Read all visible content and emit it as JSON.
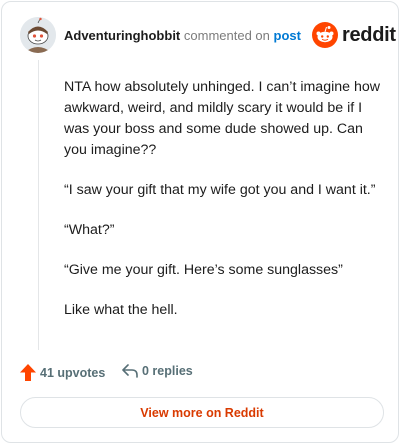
{
  "header": {
    "username": "Adventuringhobbit",
    "action_text": "commented on",
    "post_link": "post",
    "brand": "reddit"
  },
  "comment": {
    "paragraphs": [
      "NTA how absolutely unhinged. I can’t imagine how awkward, weird, and mildly scary it would be if I was your boss and some dude showed up. Can you imagine??",
      "“I saw your gift that my wife got you and I want it.”",
      "“What?”",
      "“Give me your gift. Here’s some sunglasses”",
      "Like what the hell."
    ]
  },
  "footer": {
    "upvotes": "41 upvotes",
    "replies": "0 replies",
    "view_more": "View more on Reddit"
  },
  "colors": {
    "upvote": "#ff4500",
    "reddit_orange": "#ff4500",
    "link_blue": "#0079d3",
    "view_more_text": "#d93a00"
  },
  "icons": {
    "avatar": "snoo-avatar",
    "logo": "reddit-snoo-icon",
    "upvote": "upvote-arrow-icon",
    "reply": "reply-arrow-icon"
  }
}
